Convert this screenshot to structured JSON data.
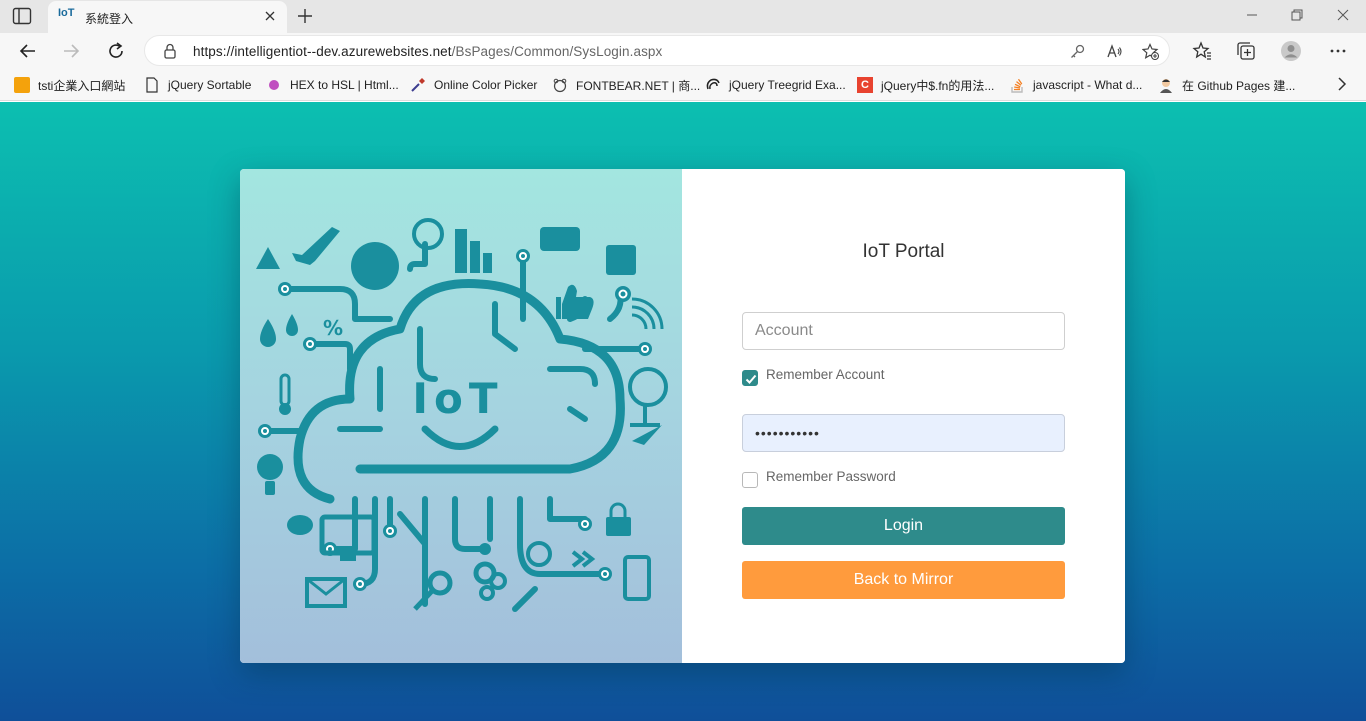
{
  "browser": {
    "tab": {
      "title": "系統登入",
      "favicon_text": "IoT"
    },
    "address": {
      "url_host": "https://intelligentiot--dev.azurewebsites.net",
      "url_path": "/BsPages/Common/SysLogin.aspx"
    },
    "bookmarks": [
      {
        "label": "tsti企業入口網站",
        "icon": "folder-orange-icon"
      },
      {
        "label": "jQuery Sortable",
        "icon": "page-icon"
      },
      {
        "label": "HEX to HSL | Html...",
        "icon": "purple-dot-icon"
      },
      {
        "label": "Online Color Picker",
        "icon": "eyedropper-icon"
      },
      {
        "label": "FONTBEAR.NET | 商...",
        "icon": "bear-icon"
      },
      {
        "label": "jQuery Treegrid Exa...",
        "icon": "swirl-icon"
      },
      {
        "label": "jQuery中$.fn的用法...",
        "icon": "red-c-icon"
      },
      {
        "label": "javascript - What d...",
        "icon": "stackoverflow-icon"
      },
      {
        "label": "在 Github Pages 建...",
        "icon": "avatar-icon"
      }
    ]
  },
  "login": {
    "title": "IoT Portal",
    "account_placeholder": "Account",
    "password_value": "•••••••••••",
    "remember_account_label": "Remember Account",
    "remember_account_checked": true,
    "remember_password_label": "Remember Password",
    "remember_password_checked": false,
    "login_button": "Login",
    "back_button": "Back to Mirror"
  },
  "illustration": {
    "logo_text": "IoT",
    "percent_text": "%"
  },
  "colors": {
    "accent": "#2e8b8b",
    "secondary": "#ff9b3d",
    "art_line": "#1a8f9e"
  }
}
